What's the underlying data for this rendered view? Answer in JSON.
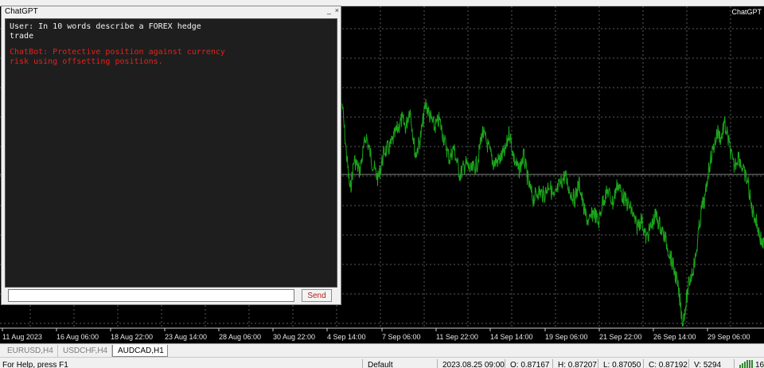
{
  "chart": {
    "label": "ChatGPT",
    "grid_color": "#5a5a5a",
    "line_color": "#1aa51a",
    "time_ticks": [
      "11 Aug 2023",
      "16 Aug 06:00",
      "18 Aug 22:00",
      "23 Aug 14:00",
      "28 Aug 06:00",
      "30 Aug 22:00",
      "4 Sep 14:00",
      "7 Sep 06:00",
      "11 Sep 22:00",
      "14 Sep 14:00",
      "19 Sep 06:00",
      "21 Sep 22:00",
      "26 Sep 14:00",
      "29 Sep 06:00"
    ]
  },
  "chat": {
    "title": "ChatGPT",
    "minimize_glyph": "_",
    "close_glyph": "×",
    "user_message": "User: In 10 words describe a FOREX hedge\ntrade",
    "bot_message": "ChatBot: Protective position against currency\nrisk using offsetting positions.",
    "input_value": "",
    "send_label": "Send",
    "user_color": "#f2f2f2",
    "bot_color": "#e8201a"
  },
  "tabs": [
    {
      "label": "EURUSD,H4",
      "active": false
    },
    {
      "label": "USDCHF,H4",
      "active": false
    },
    {
      "label": "AUDCAD,H1",
      "active": true
    }
  ],
  "status": {
    "help": "For Help, press F1",
    "profile": "Default",
    "datetime": "2023.08.25 09:00",
    "open": "O: 0.87167",
    "high": "H: 0.87207",
    "low": "L: 0.87050",
    "close": "C: 0.87192",
    "volume": "V: 5294",
    "traffic": "16"
  }
}
